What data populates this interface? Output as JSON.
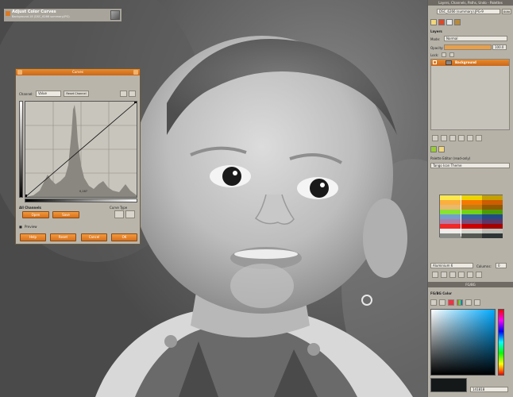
{
  "curves_dialog": {
    "window_title": "Curves",
    "heading": "Adjust Color Curves",
    "subheading": "Background-18 (DSC_6266 summary.JPG)",
    "channel_label": "Channel:",
    "channel_value": "Value",
    "reset_channel_label": "Reset Channel",
    "readout": "0,167",
    "all_channels_label": "All Channels",
    "open_label": "Open",
    "save_label": "Save",
    "curve_type_label": "Curve Type",
    "preview_label": "Preview",
    "help_label": "Help",
    "reset_label": "Reset",
    "cancel_label": "Cancel",
    "ok_label": "OK"
  },
  "layers_dock": {
    "window_title": "Layers, Channels, Paths, Undo - Palettes",
    "image_selector": "DSC_6266 (summary).JPG-9",
    "auto_label": "Auto",
    "panel_title": "Layers",
    "mode_label": "Mode:",
    "mode_value": "Normal",
    "opacity_label": "Opacity:",
    "opacity_value": "100.0",
    "lock_label": "Lock:",
    "layer_name": "Background"
  },
  "palette_dock": {
    "panel_title": "Palette Editor (read-only)",
    "palette_name": "Tango Icon Theme",
    "color_name": "Aluminium 6",
    "columns_label": "Columns:",
    "columns_value": "0",
    "swatches": [
      [
        "#fce94f",
        "#edd400",
        "#c4a000"
      ],
      [
        "#fcaf3e",
        "#f57900",
        "#ce5c00"
      ],
      [
        "#e9b96e",
        "#c17d11",
        "#8f5902"
      ],
      [
        "#8ae234",
        "#73d216",
        "#4e9a06"
      ],
      [
        "#729fcf",
        "#3465a4",
        "#204a87"
      ],
      [
        "#ad7fa8",
        "#75507b",
        "#5c3566"
      ],
      [
        "#ef2929",
        "#cc0000",
        "#a40000"
      ],
      [
        "#eeeeec",
        "#d3d7cf",
        "#babdb6"
      ],
      [
        "#888a85",
        "#555753",
        "#2e3436"
      ]
    ]
  },
  "fg_dock": {
    "window_title": "FG/BG",
    "panel_title": "FG/BG Color",
    "hex_value": "141818"
  }
}
